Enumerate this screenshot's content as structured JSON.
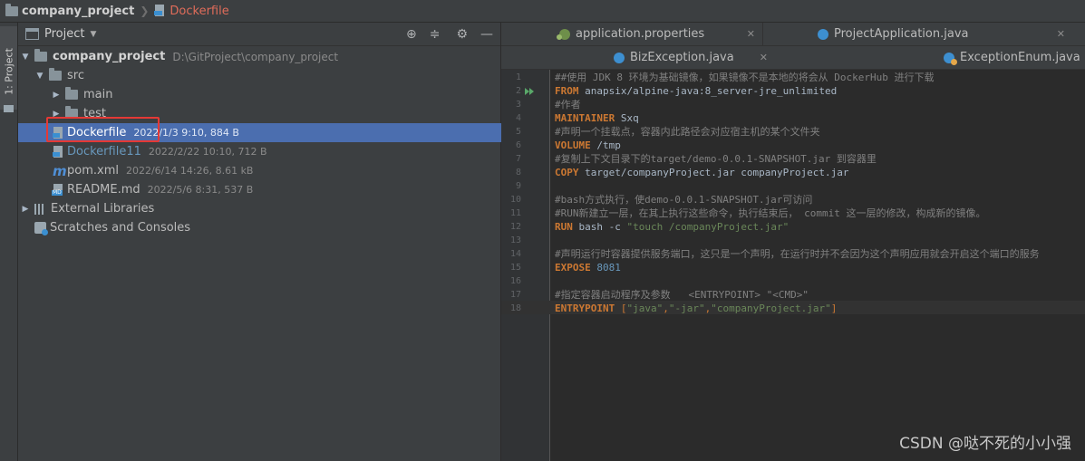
{
  "breadcrumb": {
    "project": "company_project",
    "file": "Dockerfile"
  },
  "toolstrip": {
    "tab_label": "1: Project"
  },
  "project_panel": {
    "title": "Project",
    "tools": [
      "locate-icon",
      "collapse-icon",
      "gear-icon",
      "minimize-icon"
    ],
    "tree": {
      "root_name": "company_project",
      "root_path": "D:\\GitProject\\company_project",
      "src": "src",
      "main": "main",
      "test": "test",
      "files": [
        {
          "name": "Dockerfile",
          "meta": "2022/1/3 9:10, 884 B"
        },
        {
          "name": "Dockerfile11",
          "meta": "2022/2/22 10:10, 712 B"
        },
        {
          "name": "pom.xml",
          "meta": "2022/6/14 14:26, 8.61 kB"
        },
        {
          "name": "README.md",
          "meta": "2022/5/6 8:31, 537 B"
        }
      ],
      "external_libraries": "External Libraries",
      "scratches": "Scratches and Consoles"
    }
  },
  "editor": {
    "tabs_row1": [
      "application.properties",
      "ProjectApplication.java"
    ],
    "tabs_row2": [
      "BizException.java",
      "ExceptionEnum.java"
    ],
    "code": {
      "l1": "##使用 JDK 8 环境为基础镜像，如果镜像不是本地的将会从 DockerHub 进行下载",
      "l2_kw": "FROM",
      "l2_val": " anapsix/alpine-java:8_server-jre_unlimited",
      "l3": "#作者",
      "l4_kw": "MAINTAINER",
      "l4_val": " Sxq",
      "l5": "#声明一个挂载点，容器内此路径会对应宿主机的某个文件夹",
      "l6_kw": "VOLUME",
      "l6_val": " /tmp",
      "l7": "#复制上下文目录下的target/demo-0.0.1-SNAPSHOT.jar 到容器里",
      "l8_kw": "COPY",
      "l8_val": " target/companyProject.jar companyProject.jar",
      "l10": "#bash方式执行，使demo-0.0.1-SNAPSHOT.jar可访问",
      "l11": "#RUN新建立一层，在其上执行这些命令，执行结束后， commit 这一层的修改，构成新的镜像。",
      "l12_kw": "RUN",
      "l12_val": " bash -c ",
      "l12_str": "\"touch /companyProject.jar\"",
      "l14": "#声明运行时容器提供服务端口，这只是一个声明，在运行时并不会因为这个声明应用就会开启这个端口的服务",
      "l15_kw": "EXPOSE",
      "l15_num": " 8081",
      "l17": "#指定容器启动程序及参数   <ENTRYPOINT> \"<CMD>\"",
      "l18_kw": "ENTRYPOINT",
      "l18_open": " [",
      "l18_s1": "\"java\"",
      "l18_c1": ",",
      "l18_s2": "\"-jar\"",
      "l18_c2": ",",
      "l18_s3": "\"companyProject.jar\"",
      "l18_close": "]"
    }
  },
  "watermark": "CSDN @哒不死的小小强"
}
